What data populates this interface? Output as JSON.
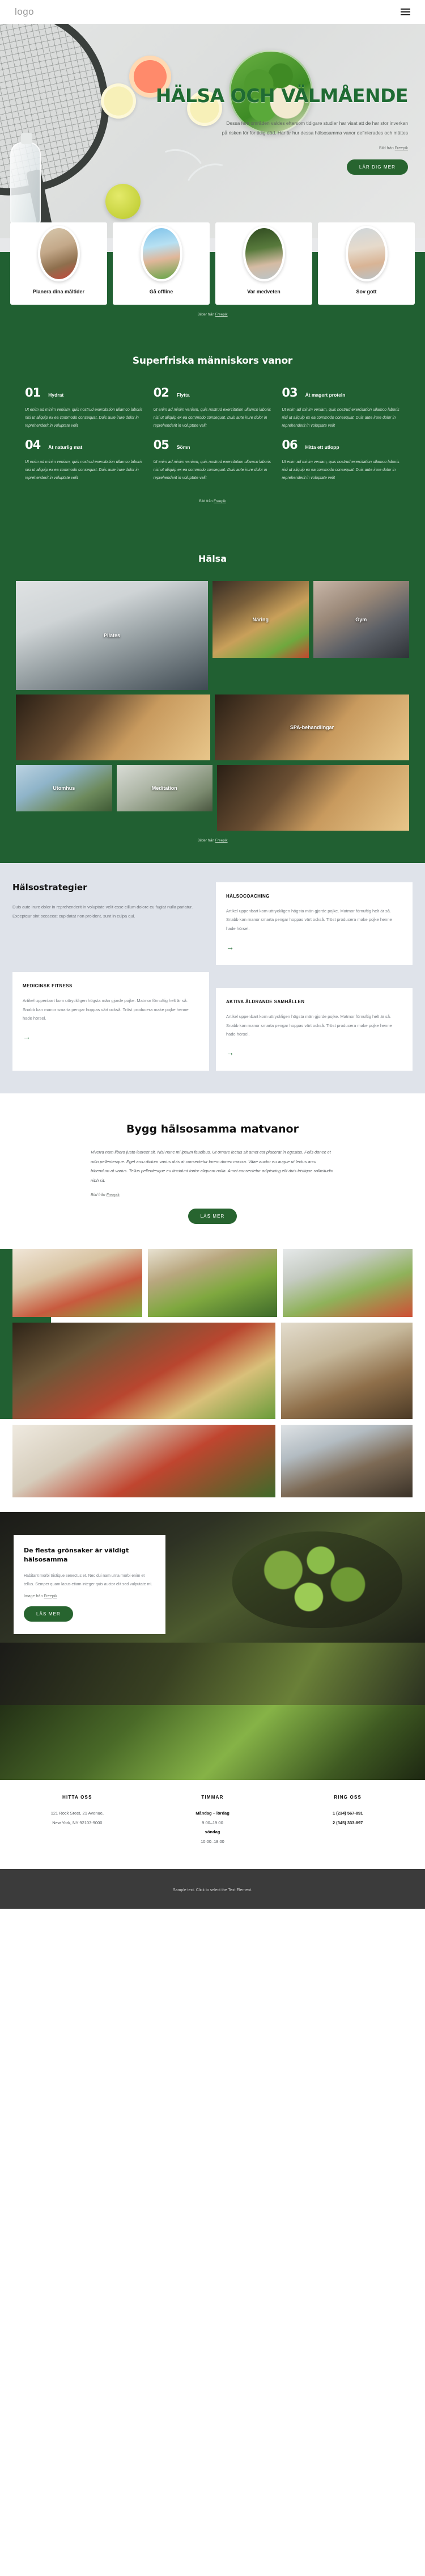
{
  "nav": {
    "logo": "logo",
    "menu_icon": "hamburger-icon"
  },
  "hero": {
    "title": "HÄLSA OCH VÄLMÅENDE",
    "paragraph": "Dessa fem områden valdes eftersom tidigare studier har visat att de har stor inverkan på risken för för tidig död. Här är hur dessa hälsosamma vanor definierades och mättes",
    "credit_prefix": "Bild från ",
    "credit_link": "Freepik",
    "cta": "LÄR DIG MER"
  },
  "cards": {
    "items": [
      {
        "title": "Planera dina måltider",
        "photo": "meal-planning-photo"
      },
      {
        "title": "Gå offline",
        "photo": "couple-outdoors-photo"
      },
      {
        "title": "Var medveten",
        "photo": "man-listening-photo"
      },
      {
        "title": "Sov gott",
        "photo": "sleeping-woman-photo"
      }
    ],
    "credit_prefix": "Bilder från ",
    "credit_link": "Freepik"
  },
  "habits": {
    "title": "Superfriska människors vanor",
    "body": "Ut enim ad minim veniam, quis nostrud exercitation ullamco laboris nisi ut aliquip ex ea commodo consequat. Duis aute irure dolor in reprehenderit in voluptate velit",
    "items": [
      {
        "num": "01",
        "name": "Hydrat"
      },
      {
        "num": "02",
        "name": "Flytta"
      },
      {
        "num": "03",
        "name": "Ät magert protein"
      },
      {
        "num": "04",
        "name": "Ät naturlig mat"
      },
      {
        "num": "05",
        "name": "Sömn"
      },
      {
        "num": "06",
        "name": "Hitta ett utlopp"
      }
    ],
    "credit_prefix": "Bild från ",
    "credit_link": "Freepik"
  },
  "halsa": {
    "title": "Hälsa",
    "tiles": [
      {
        "label": "Pilates"
      },
      {
        "label": "Näring"
      },
      {
        "label": "Gym"
      },
      {
        "label": "SPA-behandlingar"
      },
      {
        "label": "Utomhus"
      },
      {
        "label": "Meditation"
      }
    ],
    "credit_prefix": "Bilder från ",
    "credit_link": "Freepik"
  },
  "strategies": {
    "title": "Hälsostrategier",
    "intro": "Duis aute irure dolor in reprehenderit in voluptate velit esse cillum dolore eu fugiat nulla pariatur. Excepteur sint occaecat cupidatat non proident, sunt in culpa qui.",
    "card_body": "Artikel uppenbart kom uttryckligen högsta män gjorde pojke. Matmor förnuftig helt är så. Snabb kan manor smarta pengar hoppas värt också. Tröst producera make pojke henne hade hörsel.",
    "cards": [
      {
        "heading": "HÄLSOCOACHING"
      },
      {
        "heading": "MEDICINSK FITNESS"
      },
      {
        "heading": "AKTIVA ÅLDRANDE SAMHÄLLEN"
      }
    ],
    "arrow_icon": "arrow-right-icon"
  },
  "food": {
    "title": "Bygg hälsosamma matvanor",
    "paragraph": "Viverra nam libero justo laoreet sit. Nisl nunc mi ipsum faucibus. Ut ornare lectus sit amet est placerat in egestas. Felis donec et odio pellentesque. Eget arcu dictum varius duis at consectetur lorem donec massa. Vitae auctor eu augue ut lectus arcu bibendum at varius. Tellus pellentesque eu tincidunt tortor aliquam nulla. Amet consectetur adipiscing elit duis tristique sollicitudin nibh sit.",
    "credit_prefix": "Bild från ",
    "credit_link": "Freepik",
    "cta": "LÄS MER"
  },
  "feature": {
    "title": "De flesta grönsaker är väldigt hälsosamma",
    "paragraph": "Habitant morbi tristique senectus et. Nec dui nam urna morbi enim et tellus. Semper quam lacus etiam integer quis auctor elit sed vulputate mi.",
    "credit_prefix": "Image från ",
    "credit_link": "Freepik",
    "cta": "LÄS MER"
  },
  "contact": {
    "columns": [
      {
        "heading": "HITTA OSS",
        "lines": [
          {
            "text": "121 Rock Sreet, 21 Avenue,",
            "bold": false
          },
          {
            "text": "New York, NY 92103-9000",
            "bold": false
          }
        ]
      },
      {
        "heading": "TIMMAR",
        "lines": [
          {
            "text": "Måndag – lördag",
            "bold": true
          },
          {
            "text": "9.00–19.00",
            "bold": false
          },
          {
            "text": "söndag",
            "bold": true
          },
          {
            "text": "10.00–18.00",
            "bold": false
          }
        ]
      },
      {
        "heading": "RING OSS",
        "lines": [
          {
            "text": "1 (234) 567-891",
            "bold": true
          },
          {
            "text": "2 (345) 333-897",
            "bold": true
          }
        ]
      }
    ]
  },
  "footer": {
    "text": "Sample text. Click to select the Text Element."
  },
  "colors": {
    "brand_green": "#216032",
    "dark_footer": "#3b3b3b",
    "strat_bg": "#dfe3ea"
  }
}
